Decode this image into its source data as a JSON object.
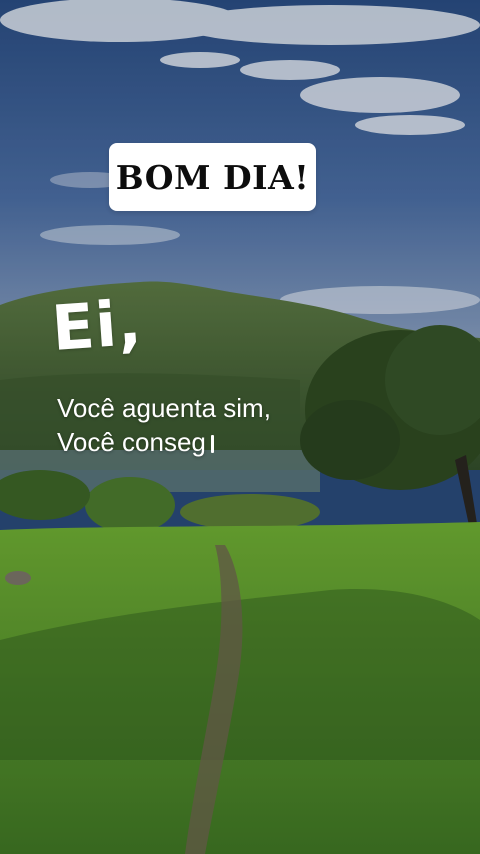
{
  "title_card": {
    "label": "BOM DIA!"
  },
  "overlay": {
    "greeting": "Ei,",
    "lines": [
      "Você aguenta sim,",
      "Você conseg"
    ]
  },
  "scene": {
    "description_icons": [
      "sky",
      "clouds",
      "mountain",
      "lake",
      "tree",
      "grass-field",
      "dirt-path"
    ],
    "colors": {
      "sky_top": "#2b4f86",
      "sky_bottom": "#7d95b8",
      "mountain": "#4f6b3c",
      "grass": "#5f9a2e",
      "grass_shadow": "#3f6e25",
      "path": "#6f6350"
    }
  }
}
